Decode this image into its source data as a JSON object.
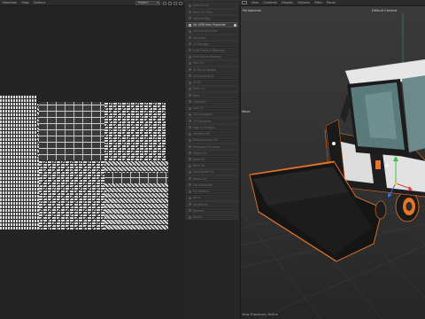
{
  "uv_menubar": {
    "items": [
      "Selection",
      "View",
      "Options"
    ],
    "mode_select": "Project"
  },
  "palette": {
    "items": [
      {
        "label": "Auto UV Init",
        "active": false
      },
      {
        "label": "Relax UV Filter",
        "active": false
      },
      {
        "label": "Optimal Map",
        "active": false
      },
      {
        "label": "Set UVW from Projection",
        "active": true,
        "has_option": true
      },
      {
        "label": "UV Grid and Relax",
        "active": false
      },
      {
        "label": "Transform",
        "active": false
      },
      {
        "label": "UV Manager",
        "active": false
      },
      {
        "label": "Auto Shortcut Mapping",
        "active": false
      },
      {
        "label": "Auto Adjust Mapping",
        "active": false
      },
      {
        "label": "Pack UV",
        "active": false
      },
      {
        "label": "UV Mirror Update",
        "active": false
      },
      {
        "label": "UV Lock to Grid",
        "active": false
      },
      {
        "label": "UV Fix",
        "active": false
      },
      {
        "label": "Stitch Lo",
        "active": false
      },
      {
        "label": "Weld",
        "active": false
      },
      {
        "label": "Unfold UV",
        "active": false
      },
      {
        "label": "Lock UV",
        "active": false
      },
      {
        "label": "UV Unwrapper",
        "active": false
      },
      {
        "label": "UV Straighten",
        "active": false
      },
      {
        "label": "Align to Straight",
        "active": false
      },
      {
        "label": "Combine UV",
        "active": false
      },
      {
        "label": "Rectangularize UV",
        "active": false
      },
      {
        "label": "Rectangle UV Island",
        "active": false
      },
      {
        "label": "Project UV",
        "active": false
      },
      {
        "label": "Scale UV",
        "active": false
      },
      {
        "label": "Move UV",
        "active": false
      },
      {
        "label": "Symmetrize UV",
        "active": false
      },
      {
        "label": "Rotate UV",
        "active": false
      },
      {
        "label": "Flip Horizontal",
        "active": false
      },
      {
        "label": "Flip Vertical",
        "active": false
      },
      {
        "label": "Mirror",
        "active": false
      },
      {
        "label": "Randomize",
        "active": false
      },
      {
        "label": "Reverse",
        "active": false
      },
      {
        "label": "Rotate",
        "active": false
      }
    ]
  },
  "viewport": {
    "menubar": [
      "View",
      "Cameras",
      "Display",
      "Options",
      "Filter",
      "Panel"
    ],
    "view_name": "Perspective",
    "camera_name": "Default Camera",
    "tool_label": "Move",
    "status_text": "View Transform: Scene"
  },
  "colors": {
    "accent_orange": "#e8732a",
    "body_black": "#1c1c1c",
    "cab_white": "#e6e6e6",
    "glass_teal": "#6c8a8c",
    "gizmo_green": "#3fbf3f",
    "gizmo_blue": "#3a6fe0",
    "gizmo_red": "#d84040"
  }
}
